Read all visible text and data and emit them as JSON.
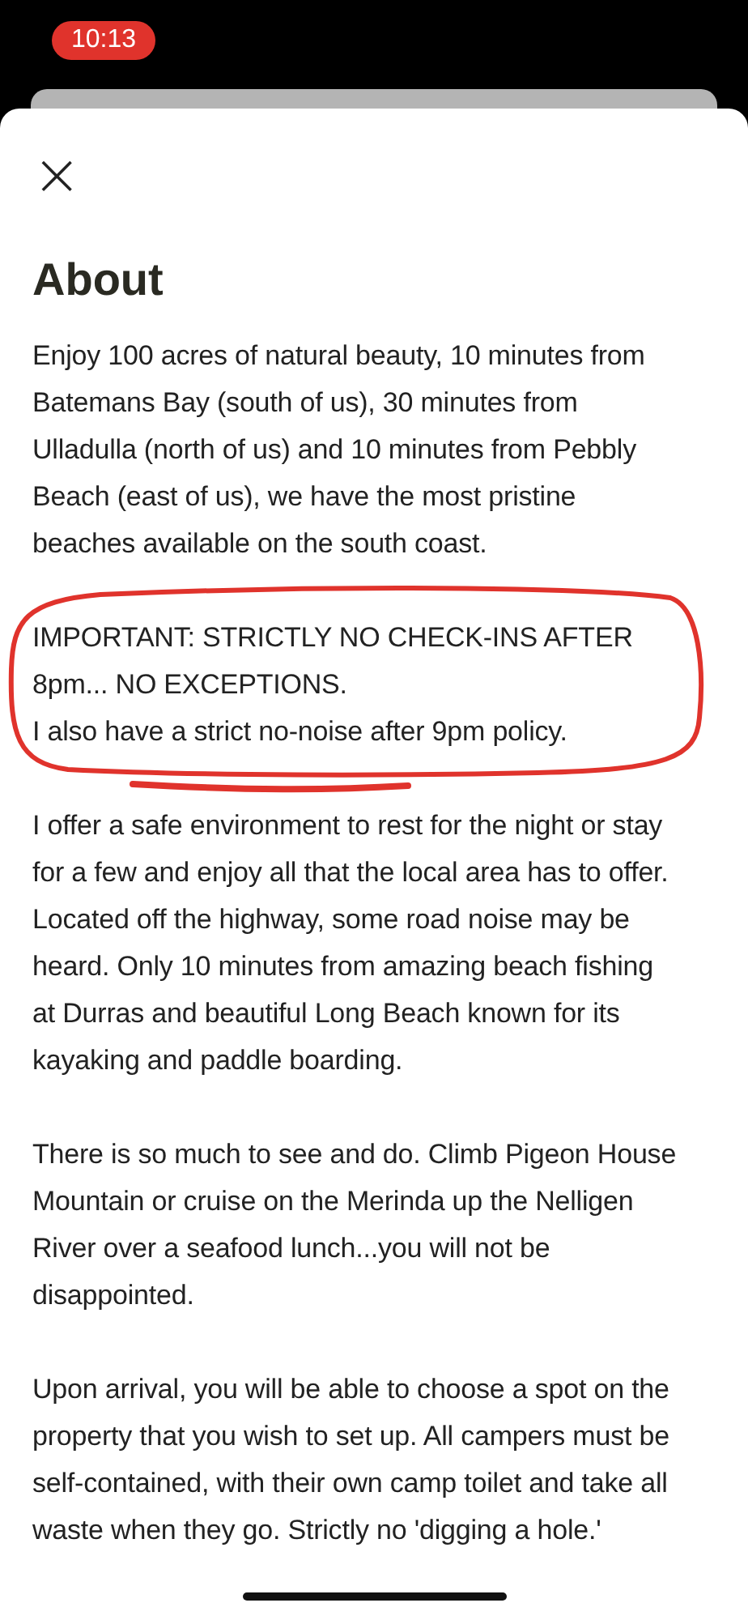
{
  "status_bar": {
    "time": "10:13"
  },
  "sheet": {
    "close_label": "×",
    "title": "About",
    "paragraphs": [
      {
        "text": "Enjoy 100 acres of natural beauty, 10 minutes from Batemans Bay (south of us), 30 minutes from Ulladulla (north of us) and 10 minutes from Pebbly Beach (east of us), we have the most pristine beaches available on the south coast."
      },
      {
        "text": "IMPORTANT: STRICTLY NO CHECK-INS AFTER 8pm... NO EXCEPTIONS.\nI also have a strict no-noise after 9pm policy.",
        "annotated": true
      },
      {
        "text": "I offer a safe environment to rest for the night or stay for a few and enjoy all that the local area has to offer. Located off the highway, some road noise may be heard. Only 10 minutes from amazing beach fishing at Durras and beautiful Long Beach known for its kayaking and paddle boarding."
      },
      {
        "text": "There is so much to see and do. Climb Pigeon House Mountain or cruise on the Merinda up the Nelligen River over a seafood lunch...you will not be disappointed."
      },
      {
        "text": "Upon arrival, you will be able to choose a spot on the property that you wish to set up. All campers must be self-contained, with their own camp toilet and take all waste when they go. Strictly no 'digging a hole.'"
      }
    ]
  }
}
